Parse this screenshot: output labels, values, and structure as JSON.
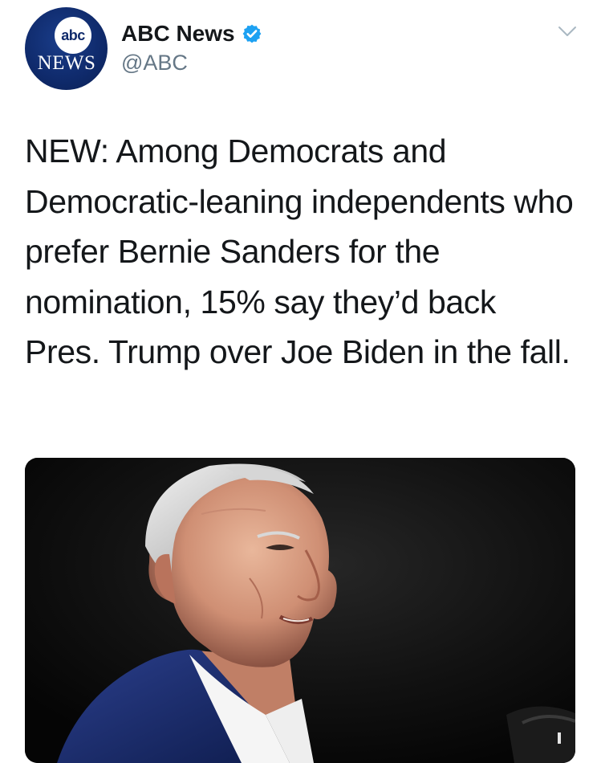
{
  "account": {
    "logo_top": "abc",
    "logo_bottom": "NEWS",
    "display_name": "ABC News",
    "handle": "@ABC",
    "verified": true,
    "verified_icon": "verified-badge-icon",
    "menu_icon": "chevron-down-icon"
  },
  "tweet": {
    "text": "NEW: Among Democrats and Democratic-leaning independents who prefer Bernie Sanders for the nomination, 15% say they’d back Pres. Trump over Joe Biden in the fall."
  },
  "colors": {
    "brand_navy": "#0f2a6b",
    "verified_blue": "#1da1f2",
    "handle_gray": "#657786",
    "text": "#14171a"
  }
}
